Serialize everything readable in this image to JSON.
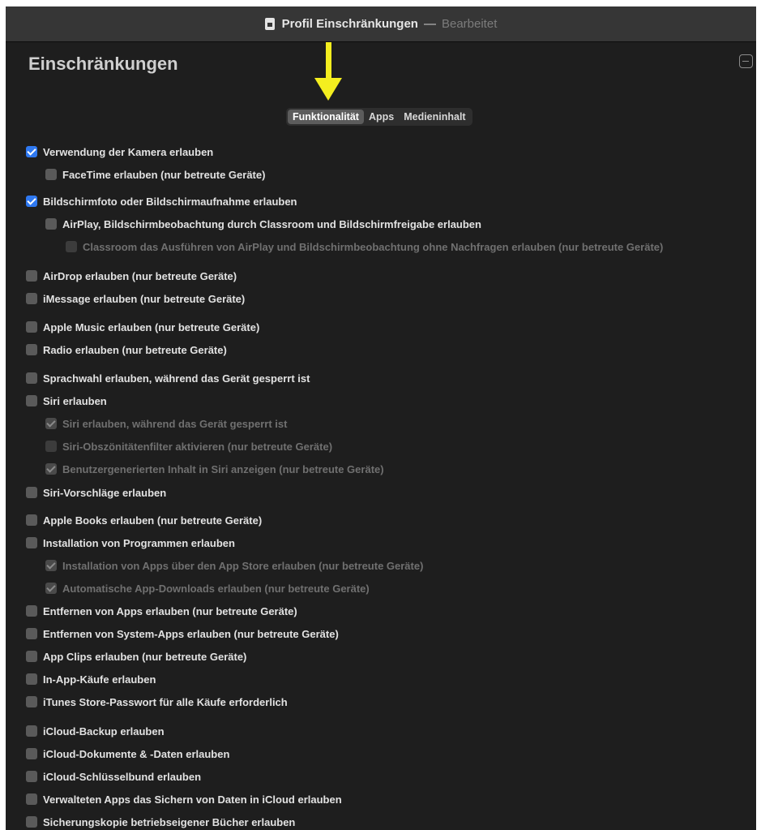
{
  "window": {
    "title": "Profil Einschränkungen",
    "separator": "—",
    "state": "Bearbeitet"
  },
  "section": {
    "heading": "Einschränkungen"
  },
  "tabs": [
    {
      "label": "Funktionalität",
      "selected": true
    },
    {
      "label": "Apps",
      "selected": false
    },
    {
      "label": "Medieninhalt",
      "selected": false
    }
  ],
  "options": [
    {
      "label": "Verwendung der Kamera erlauben",
      "checked": true,
      "enabled": true,
      "level": 0
    },
    {
      "label": "FaceTime erlauben (nur betreute Geräte)",
      "checked": false,
      "enabled": true,
      "level": 1
    },
    {
      "label": "Bildschirmfoto oder Bildschirmaufnahme erlauben",
      "checked": true,
      "enabled": true,
      "level": 0
    },
    {
      "label": "AirPlay, Bildschirmbeobachtung durch Classroom und Bildschirmfreigabe erlauben",
      "checked": false,
      "enabled": true,
      "level": 1
    },
    {
      "label": "Classroom das Ausführen von AirPlay und Bildschirmbeobachtung ohne Nachfragen erlauben (nur betreute Geräte)",
      "checked": false,
      "enabled": false,
      "level": 2
    },
    {
      "label": "AirDrop erlauben (nur betreute Geräte)",
      "checked": false,
      "enabled": true,
      "level": 0
    },
    {
      "label": "iMessage erlauben (nur betreute Geräte)",
      "checked": false,
      "enabled": true,
      "level": 0
    },
    {
      "label": "Apple Music erlauben (nur betreute Geräte)",
      "checked": false,
      "enabled": true,
      "level": 0
    },
    {
      "label": "Radio erlauben (nur betreute Geräte)",
      "checked": false,
      "enabled": true,
      "level": 0
    },
    {
      "label": "Sprachwahl erlauben, während das Gerät gesperrt ist",
      "checked": false,
      "enabled": true,
      "level": 0
    },
    {
      "label": "Siri erlauben",
      "checked": false,
      "enabled": true,
      "level": 0
    },
    {
      "label": "Siri erlauben, während das Gerät gesperrt ist",
      "checked": true,
      "enabled": false,
      "level": 1
    },
    {
      "label": "Siri-Obszönitätenfilter aktivieren (nur betreute Geräte)",
      "checked": false,
      "enabled": false,
      "level": 1
    },
    {
      "label": "Benutzergenerierten Inhalt in Siri anzeigen (nur betreute Geräte)",
      "checked": true,
      "enabled": false,
      "level": 1
    },
    {
      "label": "Siri-Vorschläge erlauben",
      "checked": false,
      "enabled": true,
      "level": 0
    },
    {
      "label": "Apple Books erlauben (nur betreute Geräte)",
      "checked": false,
      "enabled": true,
      "level": 0
    },
    {
      "label": "Installation von Programmen erlauben",
      "checked": false,
      "enabled": true,
      "level": 0
    },
    {
      "label": "Installation von Apps über den App Store erlauben (nur betreute Geräte)",
      "checked": true,
      "enabled": false,
      "level": 1
    },
    {
      "label": "Automatische App-Downloads erlauben (nur betreute Geräte)",
      "checked": true,
      "enabled": false,
      "level": 1
    },
    {
      "label": "Entfernen von Apps erlauben (nur betreute Geräte)",
      "checked": false,
      "enabled": true,
      "level": 0
    },
    {
      "label": "Entfernen von System-Apps erlauben (nur betreute Geräte)",
      "checked": false,
      "enabled": true,
      "level": 0
    },
    {
      "label": "App Clips erlauben (nur betreute Geräte)",
      "checked": false,
      "enabled": true,
      "level": 0
    },
    {
      "label": "In-App-Käufe erlauben",
      "checked": false,
      "enabled": true,
      "level": 0
    },
    {
      "label": "iTunes Store-Passwort für alle Käufe erforderlich",
      "checked": false,
      "enabled": true,
      "level": 0
    },
    {
      "label": "iCloud-Backup erlauben",
      "checked": false,
      "enabled": true,
      "level": 0
    },
    {
      "label": "iCloud-Dokumente & -Daten erlauben",
      "checked": false,
      "enabled": true,
      "level": 0
    },
    {
      "label": "iCloud-Schlüsselbund erlauben",
      "checked": false,
      "enabled": true,
      "level": 0
    },
    {
      "label": "Verwalteten Apps das Sichern von Daten in iCloud erlauben",
      "checked": false,
      "enabled": true,
      "level": 0
    },
    {
      "label": "Sicherungskopie betriebseigener Bücher erlauben",
      "checked": false,
      "enabled": true,
      "level": 0
    }
  ]
}
